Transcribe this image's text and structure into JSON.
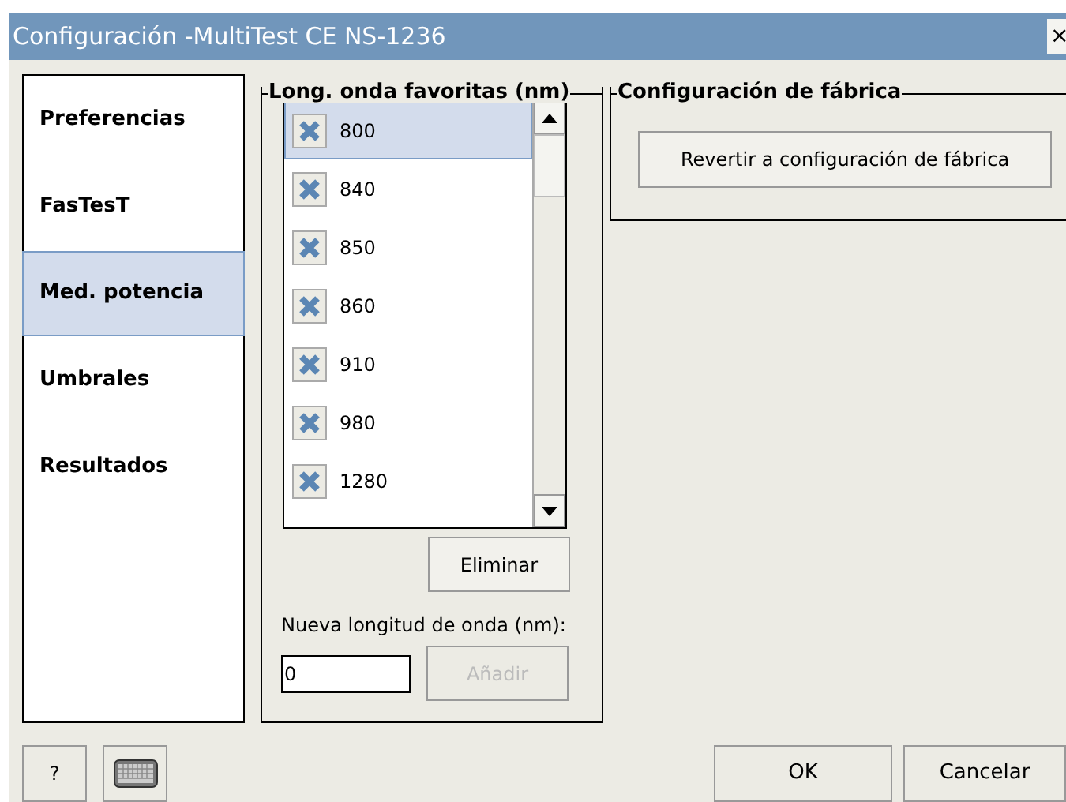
{
  "window": {
    "title": "Configuración -MultiTest CE NS-1236",
    "close": "×"
  },
  "sidebar": {
    "items": [
      {
        "label": "Preferencias",
        "selected": false
      },
      {
        "label": "FasTesT",
        "selected": false
      },
      {
        "label": "Med. potencia",
        "selected": true
      },
      {
        "label": "Umbrales",
        "selected": false
      },
      {
        "label": "Resultados",
        "selected": false
      }
    ]
  },
  "favorites": {
    "title": "Long. onda favoritas (nm)",
    "items": [
      {
        "label": "800",
        "selected": true
      },
      {
        "label": "840",
        "selected": false
      },
      {
        "label": "850",
        "selected": false
      },
      {
        "label": "860",
        "selected": false
      },
      {
        "label": "910",
        "selected": false
      },
      {
        "label": "980",
        "selected": false
      },
      {
        "label": "1280",
        "selected": false
      }
    ],
    "delete_button": "Eliminar",
    "new_label": "Nueva longitud de onda (nm):",
    "new_value": "0",
    "add_button": {
      "label": "Añadir",
      "disabled": true
    }
  },
  "factory": {
    "title": "Configuración de fábrica",
    "button": "Revertir a configuración de fábrica"
  },
  "footer": {
    "help": "?",
    "ok": "OK",
    "cancel": "Cancelar"
  }
}
